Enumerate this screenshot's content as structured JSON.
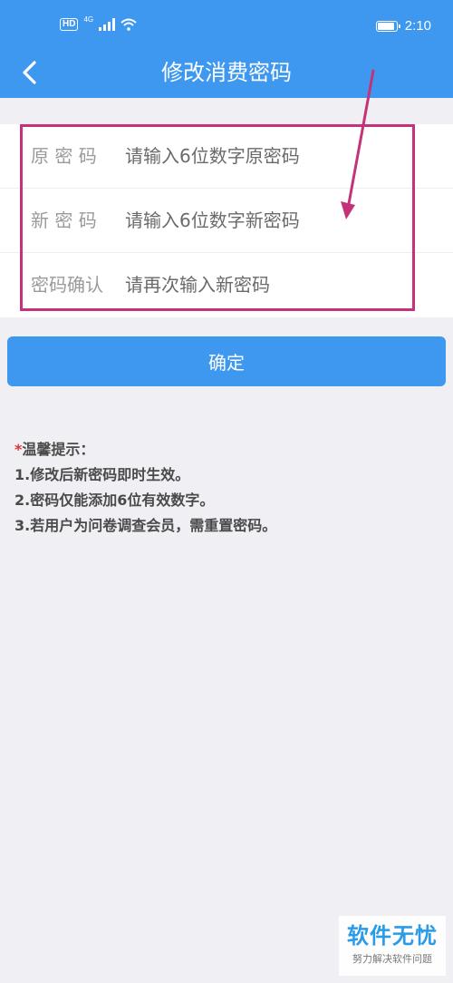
{
  "status_bar": {
    "hd": "HD",
    "network": "4G",
    "time": "2:10",
    "battery_level": 0.9
  },
  "header": {
    "title": "修改消费密码"
  },
  "form": {
    "fields": [
      {
        "label": "原 密 码",
        "placeholder": "请输入6位数字原密码",
        "value": ""
      },
      {
        "label": "新 密 码",
        "placeholder": "请输入6位数字新密码",
        "value": ""
      },
      {
        "label": "密码确认",
        "placeholder": "请再次输入新密码",
        "value": ""
      }
    ]
  },
  "confirm_button": {
    "label": "确定"
  },
  "tips": {
    "star": "*",
    "title": "温馨提示：",
    "items": [
      "1.修改后新密码即时生效。",
      "2.密码仅能添加6位有效数字。",
      "3.若用户为问卷调查会员，需重置密码。"
    ]
  },
  "watermark": {
    "main": "软件无忧",
    "sub": "努力解决软件问题"
  },
  "colors": {
    "primary": "#3e98f0",
    "background": "#efeff4",
    "annotation": "#c4337a",
    "tip_star": "#e0303a",
    "watermark": "#2a9be6"
  },
  "icons": {
    "back": "chevron-left-icon",
    "wifi": "wifi-icon",
    "signal": "signal-icon",
    "battery": "battery-icon"
  }
}
